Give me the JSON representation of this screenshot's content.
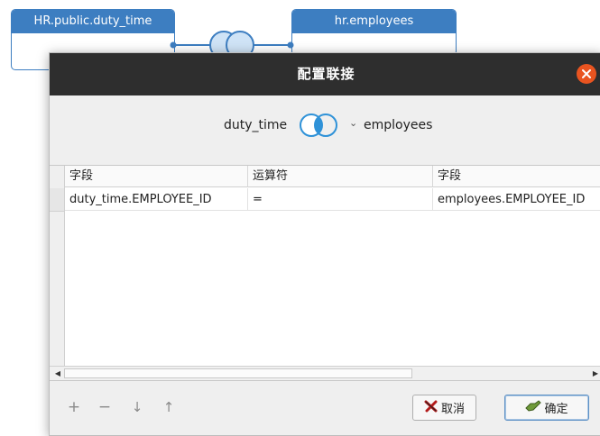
{
  "canvas": {
    "left_table": {
      "title": "HR.public.duty_time"
    },
    "right_table": {
      "title": "hr.employees"
    }
  },
  "dialog": {
    "title": "配置联接",
    "close_icon": "close-icon",
    "join": {
      "left_table": "duty_time",
      "right_table": "employees",
      "join_type_icon": "inner-join-venn-icon"
    },
    "grid": {
      "columns": [
        "字段",
        "运算符",
        "字段"
      ],
      "rows": [
        [
          "duty_time.EMPLOYEE_ID",
          "=",
          "employees.EMPLOYEE_ID"
        ]
      ]
    },
    "toolbar": {
      "add": "+",
      "remove": "−",
      "move_down": "↓",
      "move_up": "↑"
    },
    "buttons": {
      "cancel": "取消",
      "ok": "确定"
    }
  },
  "colors": {
    "accent": "#3d7ec1",
    "titlebar": "#2e2e2e",
    "close": "#e95420",
    "venn": "#2f92d8"
  }
}
